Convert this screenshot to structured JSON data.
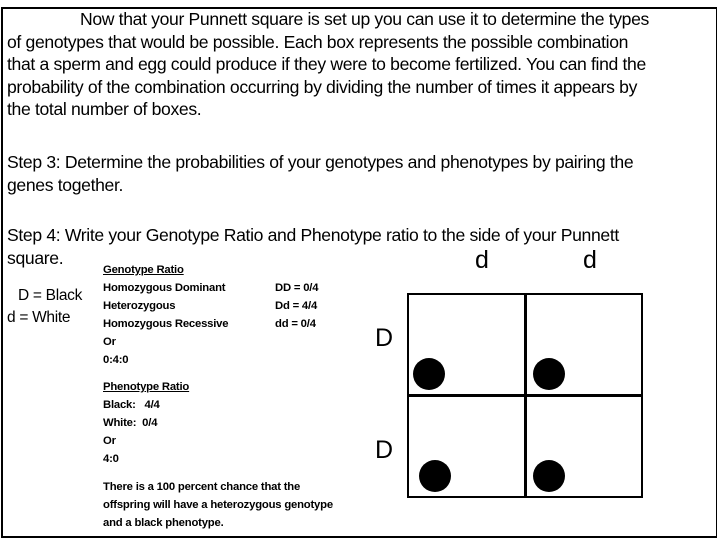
{
  "intro_paragraph": {
    "lines": [
      "Now that your Punnett square is set up you can use it to determine the types",
      "of genotypes that would be possible.  Each box represents the possible combination",
      "that a sperm and egg could produce if they were to become fertilized. You can find the",
      "probability of the combination occurring by dividing the number of times it appears by",
      "the total number of boxes."
    ]
  },
  "step3": {
    "lines": [
      "Step 3:  Determine the probabilities of your genotypes and phenotypes by pairing the",
      "genes together."
    ]
  },
  "step4": {
    "lines": [
      "Step 4: Write your Genotype Ratio and Phenotype ratio to the side of your Punnett",
      "square."
    ]
  },
  "key": {
    "dominant": "D = Black",
    "recessive": "d = White"
  },
  "genotype_ratio": {
    "heading": "Genotype Ratio",
    "rows": [
      {
        "label": "Homozygous Dominant",
        "value": "DD = 0/4"
      },
      {
        "label": "Heterozygous",
        "value": "Dd = 4/4"
      },
      {
        "label": "Homozygous Recessive",
        "value": "dd = 0/4"
      }
    ],
    "or_label": "Or",
    "ratio": "0:4:0"
  },
  "phenotype_ratio": {
    "heading": "Phenotype Ratio",
    "black": "Black:   4/4",
    "white": "White:  0/4",
    "or_label": "Or",
    "ratio": "4:0"
  },
  "conclusion": {
    "lines": [
      "There is a 100 percent chance that the",
      "offspring will have a heterozygous genotype",
      "and a black phenotype."
    ]
  },
  "punnett_square": {
    "column_alleles": [
      "d",
      "d"
    ],
    "row_alleles": [
      "D",
      "D"
    ],
    "cells": [
      {
        "row": 0,
        "col": 0,
        "marker": "black-dot"
      },
      {
        "row": 0,
        "col": 1,
        "marker": "black-dot"
      },
      {
        "row": 1,
        "col": 0,
        "marker": "black-dot"
      },
      {
        "row": 1,
        "col": 1,
        "marker": "black-dot"
      }
    ],
    "marker_color": "#000000"
  }
}
